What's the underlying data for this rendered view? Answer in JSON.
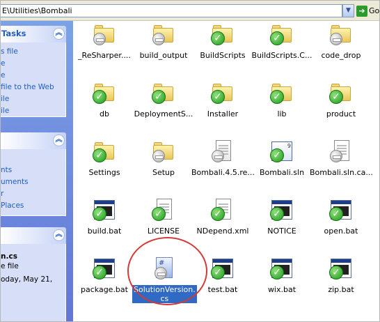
{
  "address": {
    "path": "E\\Utilities\\Bombali",
    "go_label": "Go"
  },
  "tasks_panel": {
    "title": "Tasks",
    "links": [
      "s file",
      "e",
      "e",
      "file to the Web",
      "ile",
      "ile"
    ]
  },
  "places_panel": {
    "links": [
      "nts",
      "uments",
      "r",
      "Places"
    ]
  },
  "details_panel": {
    "name": "n.cs",
    "type": "e file",
    "date": "oday, May 21,"
  },
  "files": [
    {
      "label": "_ReSharper....",
      "icon": "folder-unversioned-icon"
    },
    {
      "label": "build_output",
      "icon": "folder-unversioned-icon"
    },
    {
      "label": "BuildScripts",
      "icon": "folder-ok-icon"
    },
    {
      "label": "BuildScripts.C...",
      "icon": "folder-ok-icon"
    },
    {
      "label": "code_drop",
      "icon": "folder-unversioned-icon"
    },
    {
      "label": "db",
      "icon": "folder-ok-icon"
    },
    {
      "label": "DeploymentS...",
      "icon": "folder-ok-icon"
    },
    {
      "label": "Installer",
      "icon": "folder-ok-icon"
    },
    {
      "label": "lib",
      "icon": "folder-ok-icon"
    },
    {
      "label": "product",
      "icon": "folder-ok-icon"
    },
    {
      "label": "Settings",
      "icon": "folder-ok-icon"
    },
    {
      "label": "Setup",
      "icon": "folder-unversioned-icon"
    },
    {
      "label": "Bombali.4.5.re...",
      "icon": "resharper-file-icon"
    },
    {
      "label": "Bombali.sln",
      "icon": "solution-file-icon"
    },
    {
      "label": "Bombali.sln.ca...",
      "icon": "file-unversioned-icon"
    },
    {
      "label": "build.bat",
      "icon": "batch-file-ok-icon"
    },
    {
      "label": "LICENSE",
      "icon": "document-ok-icon"
    },
    {
      "label": "NDepend.xml",
      "icon": "xml-file-icon"
    },
    {
      "label": "NOTICE",
      "icon": "batch-file-ok-icon"
    },
    {
      "label": "open.bat",
      "icon": "batch-file-ok-icon"
    },
    {
      "label": "package.bat",
      "icon": "batch-file-ok-icon"
    },
    {
      "label": "SolutionVersion.\ncs",
      "icon": "cs-file-unversioned-icon",
      "selected": true
    },
    {
      "label": "test.bat",
      "icon": "batch-file-ok-icon"
    },
    {
      "label": "wix.bat",
      "icon": "batch-file-ok-icon"
    },
    {
      "label": "zip.bat",
      "icon": "batch-file-ok-icon"
    }
  ],
  "colors": {
    "selection": "#316AC5",
    "highlight_circle": "#D23A36",
    "task_pane": "#6F8CDE"
  }
}
